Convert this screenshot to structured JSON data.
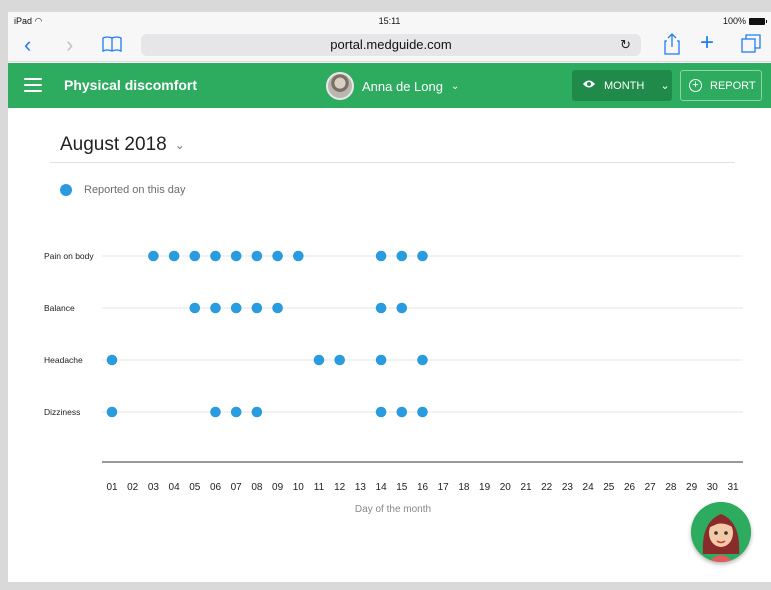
{
  "status_bar": {
    "device": "iPad",
    "time": "15:11",
    "battery": "100%"
  },
  "browser": {
    "url": "portal.medguide.com"
  },
  "app_bar": {
    "title": "Physical discomfort",
    "user_name": "Anna de Long",
    "month_button": "MONTH",
    "report_button": "REPORT"
  },
  "period": {
    "title": "August 2018"
  },
  "legend": {
    "label": "Reported on this day"
  },
  "colors": {
    "accent": "#2dab5f",
    "dot": "#2b9be0"
  },
  "chart_data": {
    "type": "scatter",
    "xlabel": "Day of the month",
    "x_ticks": [
      "01",
      "02",
      "03",
      "04",
      "05",
      "06",
      "07",
      "08",
      "09",
      "10",
      "11",
      "12",
      "13",
      "14",
      "15",
      "16",
      "17",
      "18",
      "19",
      "20",
      "21",
      "22",
      "23",
      "24",
      "25",
      "26",
      "27",
      "28",
      "29",
      "30",
      "31"
    ],
    "series": [
      {
        "name": "Pain on body",
        "days": [
          3,
          4,
          5,
          6,
          7,
          8,
          9,
          10,
          14,
          15,
          16
        ]
      },
      {
        "name": "Balance",
        "days": [
          5,
          6,
          7,
          8,
          9,
          14,
          15
        ]
      },
      {
        "name": "Headache",
        "days": [
          1,
          11,
          12,
          14,
          16
        ]
      },
      {
        "name": "Dizziness",
        "days": [
          1,
          6,
          7,
          8,
          14,
          15,
          16
        ]
      }
    ]
  }
}
